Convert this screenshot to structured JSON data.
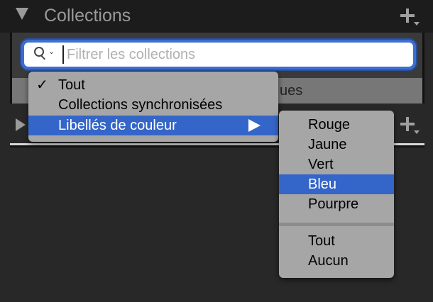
{
  "panel": {
    "title": "Collections"
  },
  "search": {
    "placeholder": "Filtrer les collections",
    "partial_label": "ues"
  },
  "filter_menu": {
    "items": [
      {
        "label": "Tout",
        "checked": true
      },
      {
        "label": "Collections synchronisées",
        "checked": false
      },
      {
        "label": "Libellés de couleur",
        "checked": false,
        "highlighted": true,
        "has_submenu": true
      }
    ],
    "check_mark": "✓"
  },
  "color_submenu": {
    "items": [
      "Rouge",
      "Jaune",
      "Vert",
      "Bleu",
      "Pourpre"
    ],
    "highlighted": "Bleu",
    "extra_items": [
      "Tout",
      "Aucun"
    ]
  },
  "icons": {
    "disclosure": "triangle-down-icon",
    "add": "plus-icon",
    "search": "magnifier-icon",
    "submenu": "triangle-right-icon"
  },
  "colors": {
    "highlight": "#3465c8",
    "menu_bg": "#a6a6a6",
    "panel_bg": "#282828",
    "focus_ring": "#3c6fd0"
  }
}
